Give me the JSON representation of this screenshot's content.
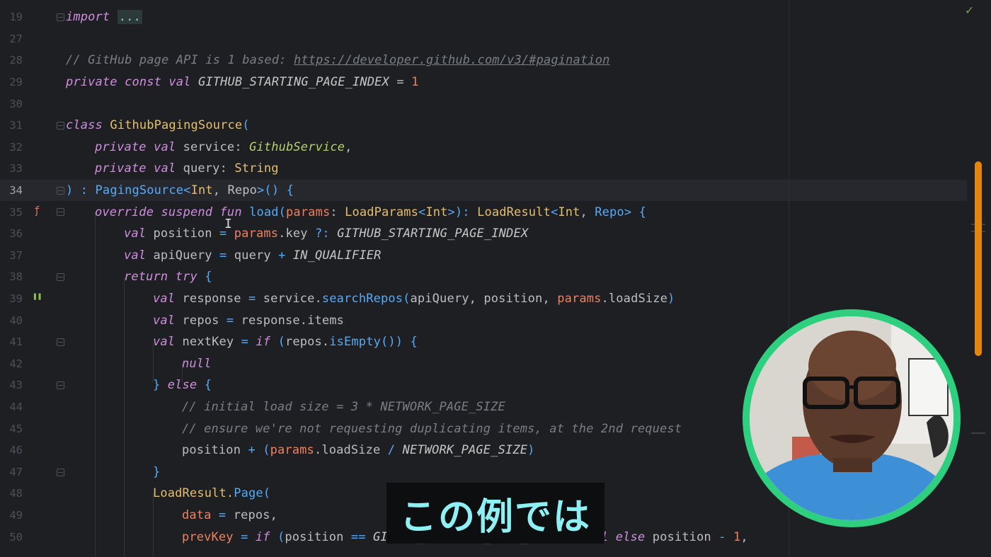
{
  "editor": {
    "lines": [
      {
        "n": "19",
        "indent": 0,
        "tokens": [
          {
            "t": "import ",
            "c": "kw"
          },
          {
            "t": "...",
            "c": "fold-ellipsis"
          }
        ]
      },
      {
        "n": "27",
        "indent": 0,
        "tokens": []
      },
      {
        "n": "28",
        "indent": 0,
        "tokens": [
          {
            "t": "// GitHub page API is 1 based: ",
            "c": "cmt"
          },
          {
            "t": "https://developer.github.com/v3/#pagination",
            "c": "link"
          }
        ]
      },
      {
        "n": "29",
        "indent": 0,
        "tokens": [
          {
            "t": "private const val ",
            "c": "kw"
          },
          {
            "t": "GITHUB_STARTING_PAGE_INDEX",
            "c": "const"
          },
          {
            "t": " = ",
            "c": "prop"
          },
          {
            "t": "1",
            "c": "num"
          }
        ]
      },
      {
        "n": "30",
        "indent": 0,
        "tokens": []
      },
      {
        "n": "31",
        "indent": 0,
        "tokens": [
          {
            "t": "class ",
            "c": "kw"
          },
          {
            "t": "GithubPagingSource",
            "c": "cls"
          },
          {
            "t": "(",
            "c": "punc"
          }
        ]
      },
      {
        "n": "32",
        "indent": 1,
        "tokens": [
          {
            "t": "private val ",
            "c": "kw"
          },
          {
            "t": "service",
            "c": "prop"
          },
          {
            "t": ": ",
            "c": "prop"
          },
          {
            "t": "GithubService",
            "c": "typeit"
          },
          {
            "t": ",",
            "c": "prop"
          }
        ]
      },
      {
        "n": "33",
        "indent": 1,
        "tokens": [
          {
            "t": "private val ",
            "c": "kw"
          },
          {
            "t": "query",
            "c": "prop"
          },
          {
            "t": ": ",
            "c": "prop"
          },
          {
            "t": "String",
            "c": "type"
          }
        ]
      },
      {
        "n": "34",
        "indent": 0,
        "current": true,
        "tokens": [
          {
            "t": ") : ",
            "c": "punc"
          },
          {
            "t": "PagingSource",
            "c": "fn"
          },
          {
            "t": "<",
            "c": "punc"
          },
          {
            "t": "Int",
            "c": "type"
          },
          {
            "t": ", ",
            "c": "prop"
          },
          {
            "t": "Repo",
            "c": "prop"
          },
          {
            "t": ">() {",
            "c": "punc"
          }
        ]
      },
      {
        "n": "35",
        "indent": 1,
        "tokens": [
          {
            "t": "override suspend ",
            "c": "kw"
          },
          {
            "t": "fun ",
            "c": "kw"
          },
          {
            "t": "load",
            "c": "fn"
          },
          {
            "t": "(",
            "c": "punc"
          },
          {
            "t": "params",
            "c": "param"
          },
          {
            "t": ": ",
            "c": "prop"
          },
          {
            "t": "LoadParams",
            "c": "type"
          },
          {
            "t": "<",
            "c": "punc"
          },
          {
            "t": "Int",
            "c": "type"
          },
          {
            "t": ">): ",
            "c": "punc"
          },
          {
            "t": "LoadResult",
            "c": "type"
          },
          {
            "t": "<",
            "c": "punc"
          },
          {
            "t": "Int",
            "c": "type"
          },
          {
            "t": ", ",
            "c": "prop"
          },
          {
            "t": "Repo",
            "c": "fn"
          },
          {
            "t": "> {",
            "c": "punc"
          }
        ]
      },
      {
        "n": "36",
        "indent": 2,
        "tokens": [
          {
            "t": "val ",
            "c": "kw"
          },
          {
            "t": "position",
            "c": "prop"
          },
          {
            "t": " = ",
            "c": "punc"
          },
          {
            "t": "params",
            "c": "param"
          },
          {
            "t": ".key ",
            "c": "prop"
          },
          {
            "t": "?: ",
            "c": "punc"
          },
          {
            "t": "GITHUB_STARTING_PAGE_INDEX",
            "c": "const"
          }
        ]
      },
      {
        "n": "37",
        "indent": 2,
        "tokens": [
          {
            "t": "val ",
            "c": "kw"
          },
          {
            "t": "apiQuery",
            "c": "prop"
          },
          {
            "t": " = ",
            "c": "punc"
          },
          {
            "t": "query ",
            "c": "prop"
          },
          {
            "t": "+ ",
            "c": "punc"
          },
          {
            "t": "IN_QUALIFIER",
            "c": "const"
          }
        ]
      },
      {
        "n": "38",
        "indent": 2,
        "tokens": [
          {
            "t": "return try ",
            "c": "kw"
          },
          {
            "t": "{",
            "c": "punc"
          }
        ]
      },
      {
        "n": "39",
        "indent": 3,
        "tokens": [
          {
            "t": "val ",
            "c": "kw"
          },
          {
            "t": "response",
            "c": "prop"
          },
          {
            "t": " = ",
            "c": "punc"
          },
          {
            "t": "service.",
            "c": "prop"
          },
          {
            "t": "searchRepos",
            "c": "fn"
          },
          {
            "t": "(",
            "c": "punc"
          },
          {
            "t": "apiQuery, position, ",
            "c": "prop"
          },
          {
            "t": "params",
            "c": "param"
          },
          {
            "t": ".loadSize",
            "c": "prop"
          },
          {
            "t": ")",
            "c": "punc"
          }
        ]
      },
      {
        "n": "40",
        "indent": 3,
        "tokens": [
          {
            "t": "val ",
            "c": "kw"
          },
          {
            "t": "repos",
            "c": "prop"
          },
          {
            "t": " = ",
            "c": "punc"
          },
          {
            "t": "response.items",
            "c": "prop"
          }
        ]
      },
      {
        "n": "41",
        "indent": 3,
        "tokens": [
          {
            "t": "val ",
            "c": "kw"
          },
          {
            "t": "nextKey",
            "c": "prop"
          },
          {
            "t": " = ",
            "c": "punc"
          },
          {
            "t": "if ",
            "c": "kw"
          },
          {
            "t": "(",
            "c": "punc"
          },
          {
            "t": "repos.",
            "c": "prop"
          },
          {
            "t": "isEmpty",
            "c": "fn"
          },
          {
            "t": "()) {",
            "c": "punc"
          }
        ]
      },
      {
        "n": "42",
        "indent": 4,
        "tokens": [
          {
            "t": "null",
            "c": "kw"
          }
        ]
      },
      {
        "n": "43",
        "indent": 3,
        "tokens": [
          {
            "t": "} ",
            "c": "punc"
          },
          {
            "t": "else ",
            "c": "kw"
          },
          {
            "t": "{",
            "c": "punc"
          }
        ]
      },
      {
        "n": "44",
        "indent": 4,
        "tokens": [
          {
            "t": "// initial load size = 3 * NETWORK_PAGE_SIZE",
            "c": "cmt"
          }
        ]
      },
      {
        "n": "45",
        "indent": 4,
        "tokens": [
          {
            "t": "// ensure we're not requesting duplicating items, at the 2nd request",
            "c": "cmt"
          }
        ]
      },
      {
        "n": "46",
        "indent": 4,
        "tokens": [
          {
            "t": "position ",
            "c": "prop"
          },
          {
            "t": "+ (",
            "c": "punc"
          },
          {
            "t": "params",
            "c": "param"
          },
          {
            "t": ".loadSize ",
            "c": "prop"
          },
          {
            "t": "/ ",
            "c": "punc"
          },
          {
            "t": "NETWORK_PAGE_SIZE",
            "c": "const"
          },
          {
            "t": ")",
            "c": "punc"
          }
        ]
      },
      {
        "n": "47",
        "indent": 3,
        "tokens": [
          {
            "t": "}",
            "c": "punc"
          }
        ]
      },
      {
        "n": "48",
        "indent": 3,
        "tokens": [
          {
            "t": "LoadResult.",
            "c": "type"
          },
          {
            "t": "Page",
            "c": "fn"
          },
          {
            "t": "(",
            "c": "punc"
          }
        ]
      },
      {
        "n": "49",
        "indent": 4,
        "tokens": [
          {
            "t": "data",
            "c": "param"
          },
          {
            "t": " = ",
            "c": "punc"
          },
          {
            "t": "repos,",
            "c": "prop"
          }
        ]
      },
      {
        "n": "50",
        "indent": 4,
        "tokens": [
          {
            "t": "prevKey",
            "c": "param"
          },
          {
            "t": " = ",
            "c": "punc"
          },
          {
            "t": "if ",
            "c": "kw"
          },
          {
            "t": "(",
            "c": "punc"
          },
          {
            "t": "position ",
            "c": "prop"
          },
          {
            "t": "== ",
            "c": "punc"
          },
          {
            "t": "GITHUB_STARTING_PAGE_INDEX",
            "c": "const"
          },
          {
            "t": ") ",
            "c": "punc"
          },
          {
            "t": "null else ",
            "c": "kw"
          },
          {
            "t": "position ",
            "c": "prop"
          },
          {
            "t": "- ",
            "c": "punc"
          },
          {
            "t": "1",
            "c": "num"
          },
          {
            "t": ",",
            "c": "prop"
          }
        ]
      }
    ]
  },
  "subtitle": {
    "text": "この例では"
  },
  "colors": {
    "accent_scroll": "#e5850c",
    "ring": "#2ecf7e",
    "subtitle_text": "#8ff0f4"
  },
  "icons": {
    "check": "checkmark-icon",
    "override": "override-icon",
    "breakpoint": "pause-icon"
  }
}
